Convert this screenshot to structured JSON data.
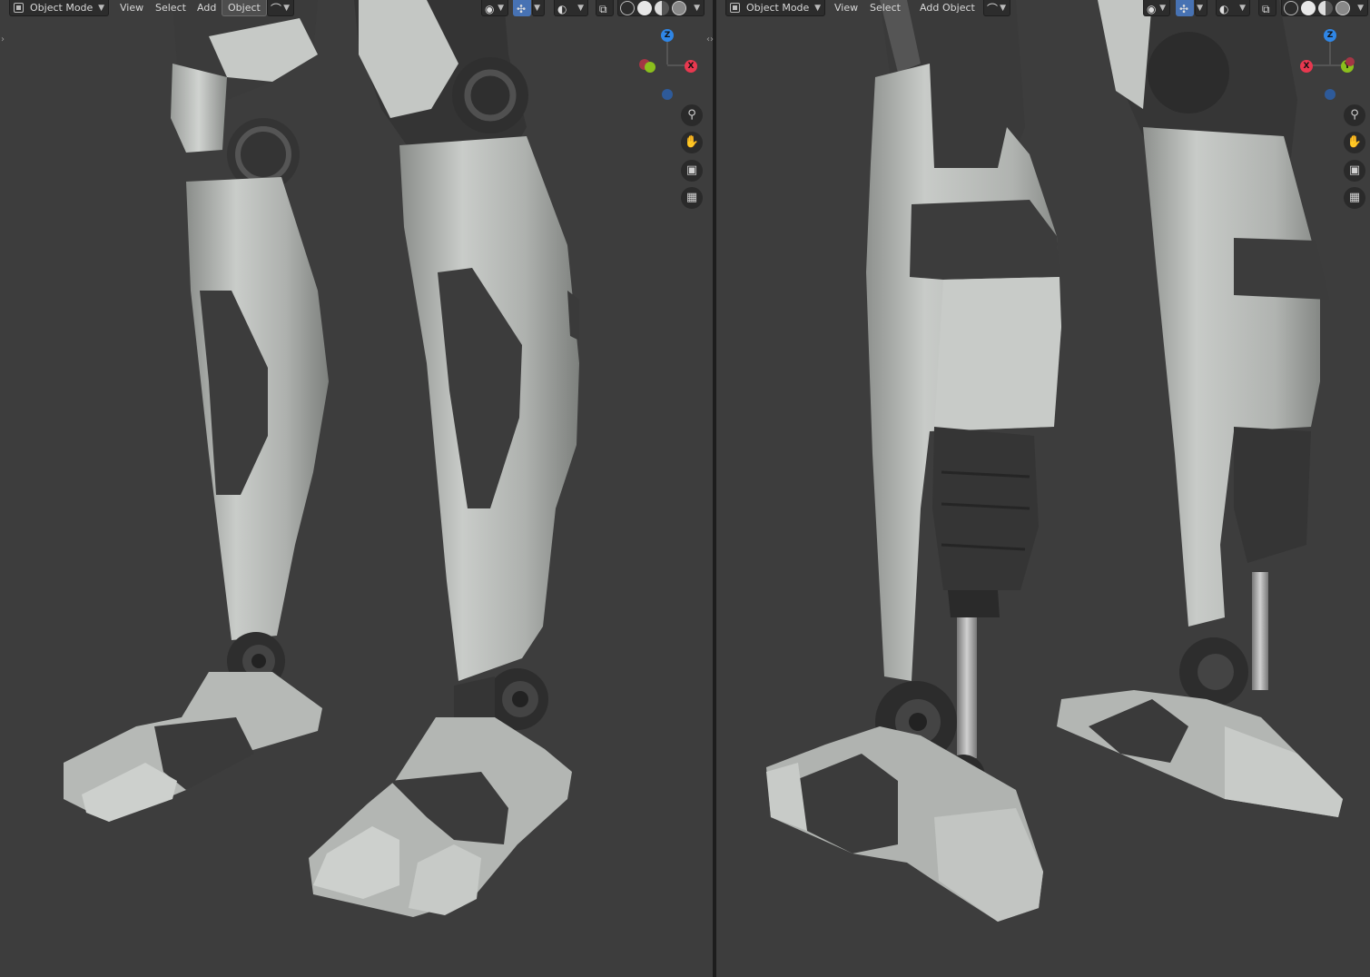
{
  "left_viewport": {
    "header": {
      "mode_label": "Object Mode",
      "menus": [
        "View",
        "Select",
        "Add",
        "Object"
      ],
      "active_menu_index": 3
    },
    "gizmo": {
      "axis_x": "X",
      "axis_z": "Z"
    }
  },
  "right_viewport": {
    "header": {
      "mode_label": "Object Mode",
      "menus": [
        "View",
        "Select",
        "Add",
        "Object"
      ]
    },
    "gizmo": {
      "axis_x": "X",
      "axis_y": "Y",
      "axis_z": "Z"
    }
  },
  "nav_icons": [
    "zoom-icon",
    "pan-hand-icon",
    "camera-icon",
    "grid-perspective-icon"
  ],
  "colors": {
    "background": "#3d3d3d",
    "armor_light": "#b4b7b4",
    "armor_dark": "#3a3a3a",
    "axis_x": "#e8384f",
    "axis_y": "#8bbf1d",
    "axis_z": "#2f86e6",
    "active_tool": "#4772b3"
  }
}
